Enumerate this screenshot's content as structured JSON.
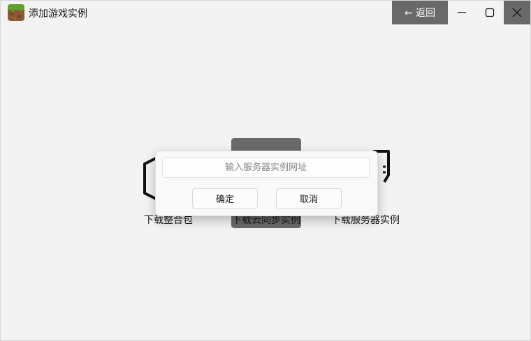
{
  "window": {
    "title": "添加游戏实例",
    "back_label": "← 返回"
  },
  "options": {
    "modpack_label": "下载整合包",
    "cloud_sync_label": "下载云同步实例",
    "server_label": "下载服务器实例"
  },
  "dialog": {
    "input_placeholder": "输入服务器实例网址",
    "input_value": "",
    "confirm_label": "确定",
    "cancel_label": "取消"
  },
  "colors": {
    "background": "#f3f3f3",
    "accent_gray": "#696969"
  }
}
